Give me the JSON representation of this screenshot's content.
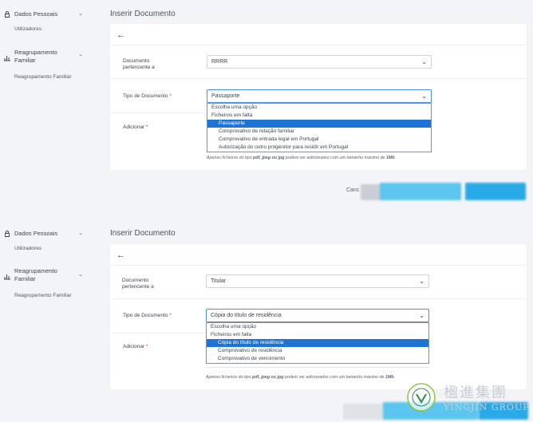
{
  "panels": [
    {
      "sidebar": {
        "section1": {
          "label": "Dados Pessoais",
          "sub": "Utilizadores"
        },
        "section2": {
          "label_line1": "Reagrupamento",
          "label_line2": "Familiar",
          "sub": "Reagrupamento Familiar"
        }
      },
      "page_title": "Inserir Documento",
      "doc_label_line1": "Documento",
      "doc_label_line2": "pertencente a",
      "doc_value": "RRRR",
      "tipo_label": "Tipo de Documento",
      "tipo_value": "Passaporte",
      "adicionar_label": "Adicionar",
      "options": [
        "Escolha uma opção",
        "Ficheiros em falta",
        "Passaporte",
        "Comprovativo de relação familiar",
        "Comprovativo de entrada legal em Portugal",
        "Autorização do outro progenitor para residir em Portugal"
      ],
      "selected_index": 2,
      "hint_pre": "Apenas ficheiros do tipo ",
      "hint_types": "pdf, jpeg ou jpg",
      "hint_mid": " podem ser adicionados com um tamanho máximo de ",
      "hint_size": "1Mb",
      "hint_end": ".",
      "cancel": "Canc"
    },
    {
      "sidebar": {
        "section1": {
          "label": "Dados Pessoais",
          "sub": "Utilizadores"
        },
        "section2": {
          "label_line1": "Reagrupamento",
          "label_line2": "Familiar",
          "sub": "Reagrupamento Familiar"
        }
      },
      "page_title": "Inserir Documento",
      "doc_label_line1": "Documento",
      "doc_label_line2": "pertencente a",
      "doc_value": "Titular",
      "tipo_label": "Tipo de Documento",
      "tipo_value": "Cópia do título de residência",
      "adicionar_label": "Adicionar",
      "options": [
        "Escolha uma opção",
        "Ficheiros em falta",
        "Cópia do título de residência",
        "Comprovativo de residência",
        "Comprovativo de vencimento"
      ],
      "selected_index": 2,
      "hint_pre": "Apenas ficheiros do tipo ",
      "hint_types": "pdf, jpeg ou jpg",
      "hint_mid": " podem ser adicionados com um tamanho máximo de ",
      "hint_size": "1Mb",
      "hint_end": "."
    }
  ],
  "required_mark": "*",
  "logo": {
    "text_cn": "楹進集團",
    "text_en": "YINGJIN GROUP"
  },
  "colors": {
    "accent": "#1e74d6",
    "button": "#29a9e8",
    "required": "#d9342b"
  },
  "icons": {
    "dados": "lock-icon",
    "reagrupamento": "bar-chart-icon",
    "back": "arrow-left-icon",
    "caret": "chevron-down-icon"
  }
}
